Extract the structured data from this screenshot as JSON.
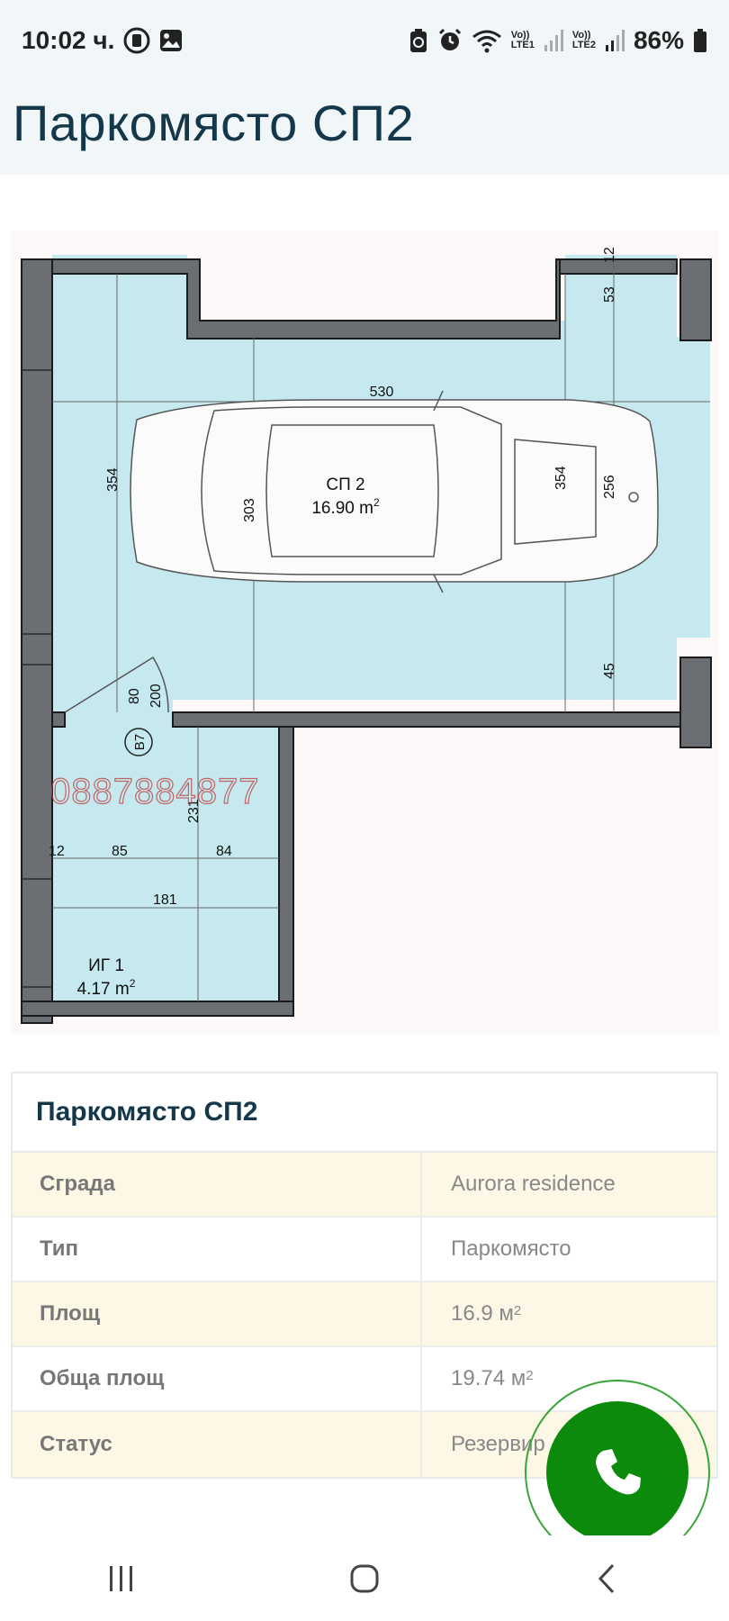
{
  "status_bar": {
    "time": "10:02 ч.",
    "sim1_top": "Vo))",
    "sim1_bottom": "LTE1",
    "sim2_top": "Vo))",
    "sim2_bottom": "LTE2",
    "battery": "86%"
  },
  "header": {
    "title": "Паркомясто СП2"
  },
  "floorplan": {
    "space_name": "СП 2",
    "space_area": "16.90 m",
    "area_sup": "2",
    "storage_name": "ИГ 1",
    "storage_area": "4.17 m",
    "storage_sup": "2",
    "door_code": "B7",
    "watermark": "0887884877",
    "dims": {
      "top_12": "12",
      "top_53": "53",
      "width_530": "530",
      "left_354": "354",
      "right_354": "354",
      "car_303": "303",
      "car_256": "256",
      "bottom_45": "45",
      "door_80": "80",
      "door_200": "200",
      "storage_231": "231",
      "storage_12": "12",
      "storage_85": "85",
      "storage_84": "84",
      "storage_181": "181"
    },
    "colors": {
      "floor": "#c5e9ef",
      "wall": "#6b6e73",
      "wall_outline": "#1b1b1b"
    }
  },
  "details": {
    "title": "Паркомясто СП2",
    "rows": [
      {
        "label": "Сграда",
        "value": "Aurora residence"
      },
      {
        "label": "Тип",
        "value": "Паркомясто"
      },
      {
        "label": "Площ",
        "value": "16.9 м",
        "sup": "2"
      },
      {
        "label": "Обща площ",
        "value": "19.74 м",
        "sup": "2"
      },
      {
        "label": "Статус",
        "value": "Резервир"
      }
    ]
  },
  "fab": {
    "icon": "phone-icon",
    "color": "#0b8a0b"
  },
  "navbar": {
    "recent_icon": "recent-apps-icon",
    "home_icon": "home-icon",
    "back_icon": "back-icon"
  }
}
